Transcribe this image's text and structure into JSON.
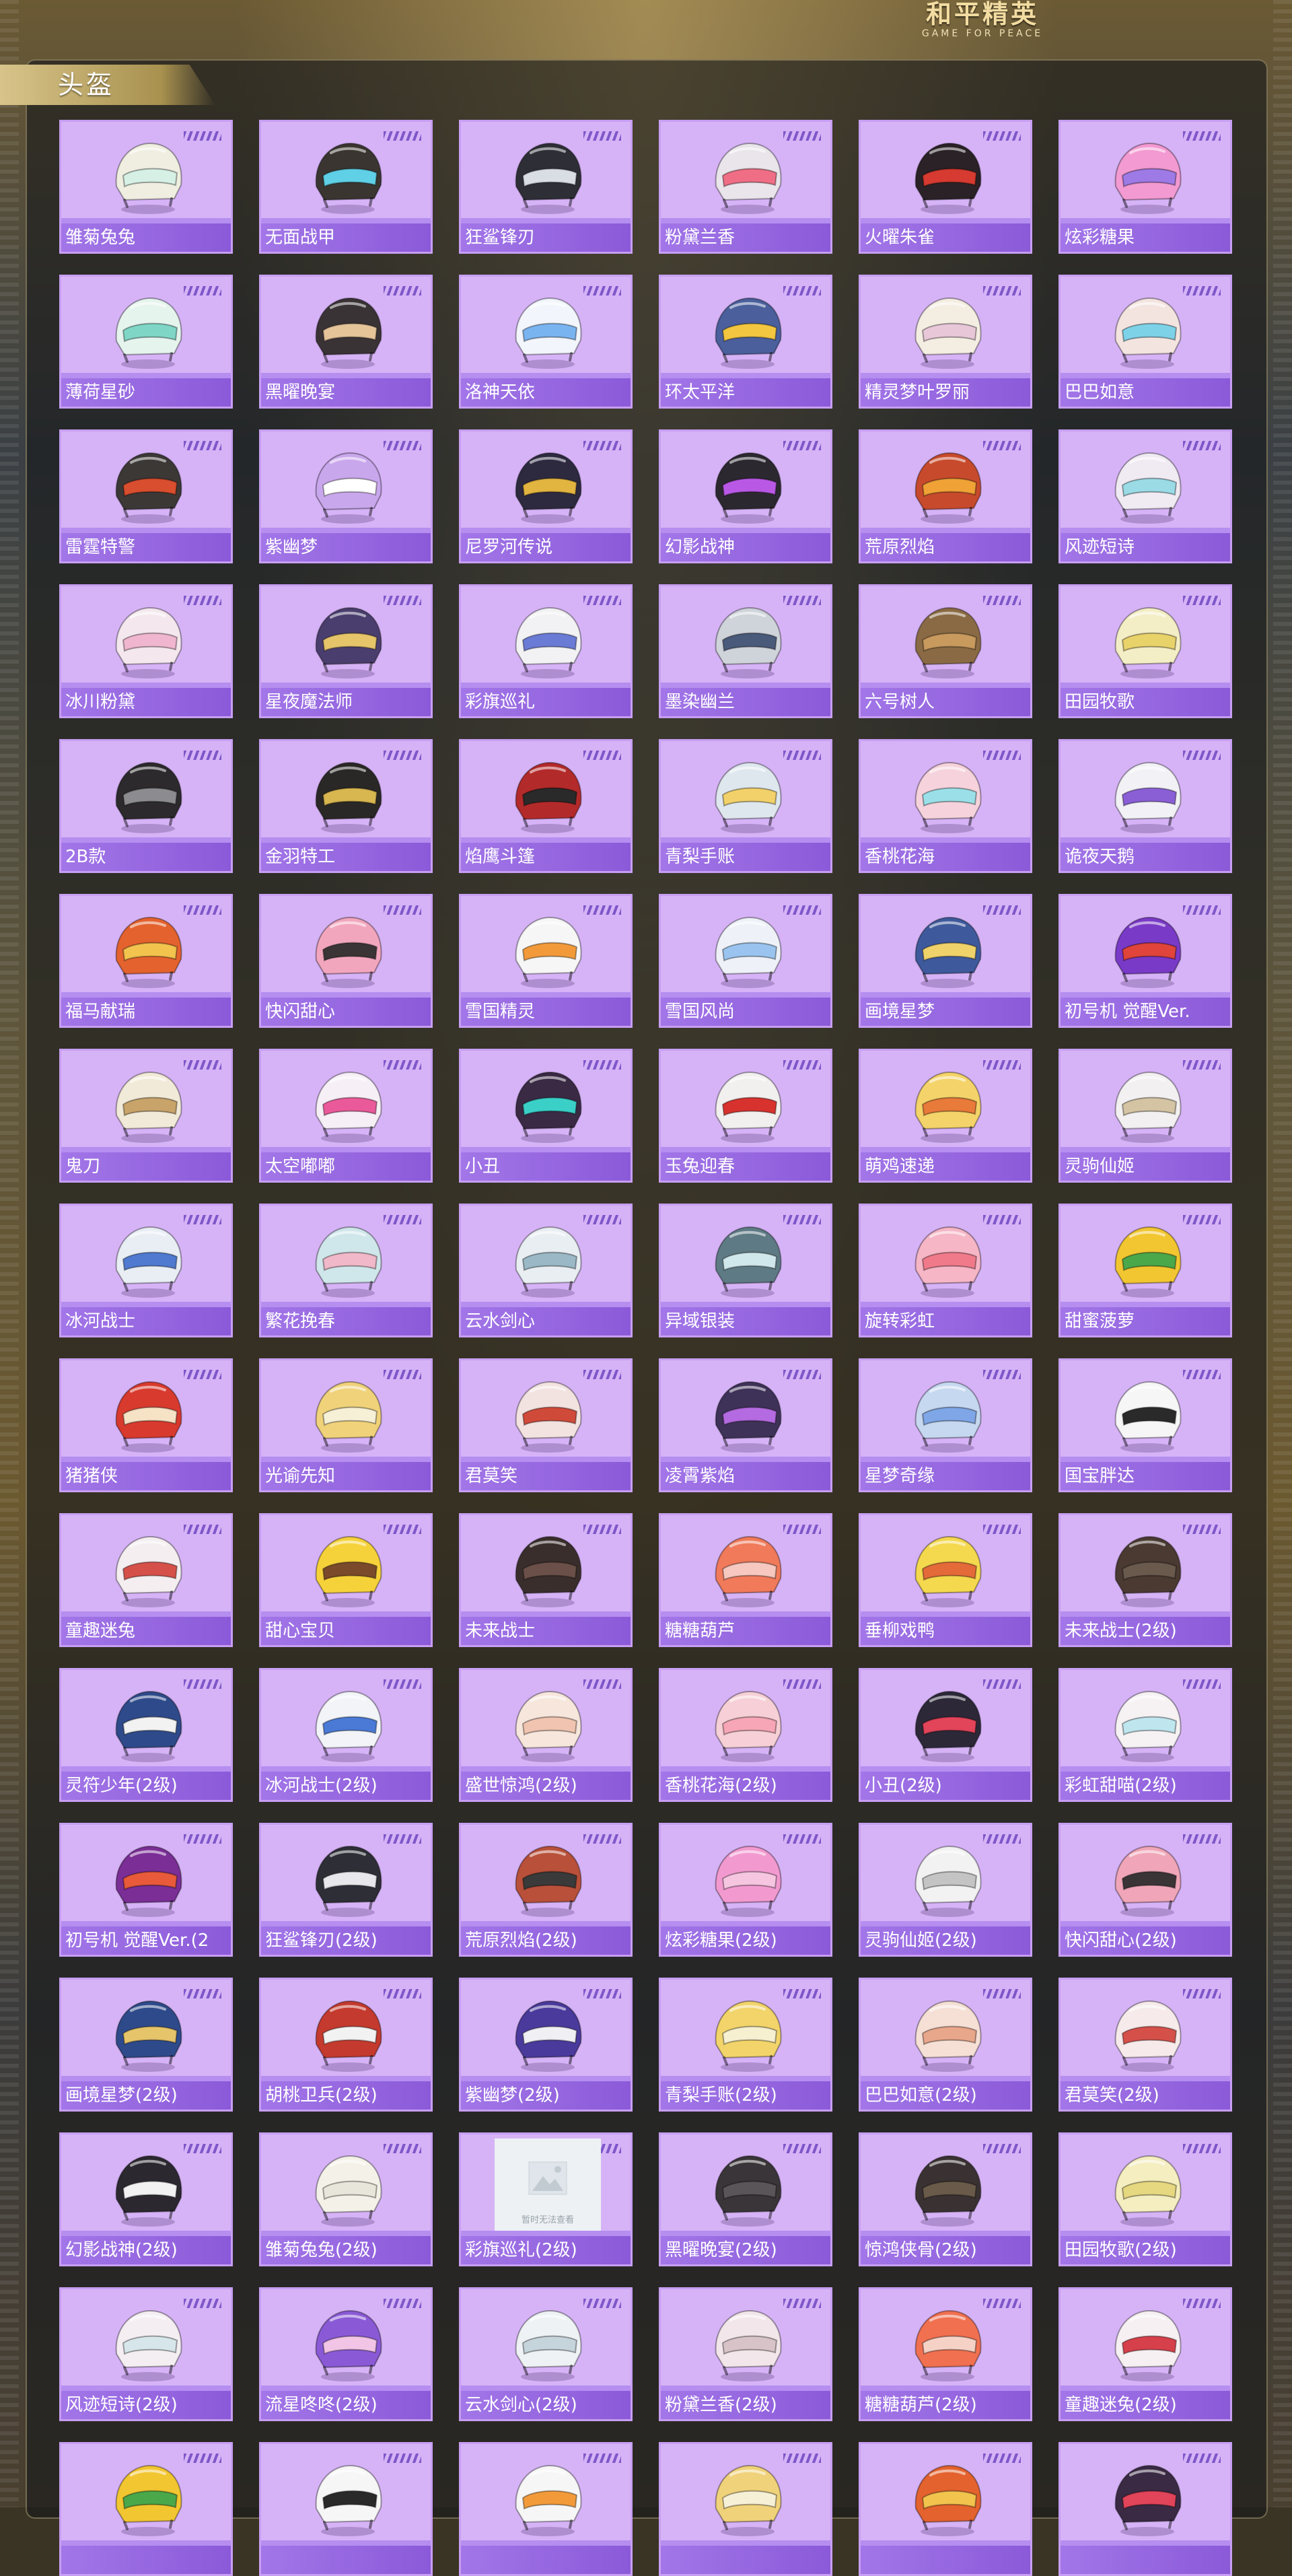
{
  "logo": {
    "main": "和平精英",
    "sub": "GAME FOR PEACE"
  },
  "section": {
    "title": "头盔"
  },
  "placeholder_text": "暂时无法查看",
  "colors": {
    "card_bg": "#d6b3f6",
    "label_bar": "#9a6ee4",
    "label_text": "#ffffff",
    "section_tab": "#c9b271"
  },
  "items": [
    {
      "name": "雏菊兔兔",
      "color": "#efeee0",
      "accent": "#d6f0e6"
    },
    {
      "name": "无面战甲",
      "color": "#3a3530",
      "accent": "#5fd0e6"
    },
    {
      "name": "狂鲨锋刃",
      "color": "#2e2f36",
      "accent": "#d9dde4"
    },
    {
      "name": "粉黛兰香",
      "color": "#e9e5ea",
      "accent": "#ef6e86"
    },
    {
      "name": "火曜朱雀",
      "color": "#2a2226",
      "accent": "#d63a30"
    },
    {
      "name": "炫彩糖果",
      "color": "#f39ad2",
      "accent": "#9e7ae6"
    },
    {
      "name": "薄荷星砂",
      "color": "#e6f4ee",
      "accent": "#7fd6c6"
    },
    {
      "name": "黑曜晚宴",
      "color": "#3a3336",
      "accent": "#e6c49a"
    },
    {
      "name": "洛神天依",
      "color": "#f2f5fb",
      "accent": "#7ab4f0"
    },
    {
      "name": "环太平洋",
      "color": "#4a5f9c",
      "accent": "#f2c640"
    },
    {
      "name": "精灵梦叶罗丽",
      "color": "#f4ede2",
      "accent": "#e8c8d8"
    },
    {
      "name": "巴巴如意",
      "color": "#f4e4e0",
      "accent": "#7ed2e8"
    },
    {
      "name": "雷霆特警",
      "color": "#3b3836",
      "accent": "#d84e2e"
    },
    {
      "name": "紫幽梦",
      "color": "#c9a7ec",
      "accent": "#ffffff"
    },
    {
      "name": "尼罗河传说",
      "color": "#2d2a40",
      "accent": "#e2b440"
    },
    {
      "name": "幻影战神",
      "color": "#2c2830",
      "accent": "#ba58e6"
    },
    {
      "name": "荒原烈焰",
      "color": "#c74a2c",
      "accent": "#f0a236"
    },
    {
      "name": "风迹短诗",
      "color": "#f0eaf2",
      "accent": "#9adbe6"
    },
    {
      "name": "冰川粉黛",
      "color": "#f4e8ee",
      "accent": "#f0b6cf"
    },
    {
      "name": "星夜魔法师",
      "color": "#4a3e6e",
      "accent": "#e6c46a"
    },
    {
      "name": "彩旗巡礼",
      "color": "#f2f2f4",
      "accent": "#6a7bd6"
    },
    {
      "name": "墨染幽兰",
      "color": "#cfd4da",
      "accent": "#4a5a7a"
    },
    {
      "name": "六号树人",
      "color": "#8a6a44",
      "accent": "#c89a5e"
    },
    {
      "name": "田园牧歌",
      "color": "#f4eec6",
      "accent": "#e8d26a"
    },
    {
      "name": "2B款",
      "color": "#2c2a2c",
      "accent": "#8c8c90"
    },
    {
      "name": "金羽特工",
      "color": "#2a2826",
      "accent": "#d8b650"
    },
    {
      "name": "焰鹰斗篷",
      "color": "#b32a2a",
      "accent": "#2a2a2a"
    },
    {
      "name": "青梨手账",
      "color": "#dfe7ee",
      "accent": "#f2d16a"
    },
    {
      "name": "香桃花海",
      "color": "#f6d3dc",
      "accent": "#9be0e8"
    },
    {
      "name": "诡夜天鹅",
      "color": "#f2f2f6",
      "accent": "#8a5fd6"
    },
    {
      "name": "福马献瑞",
      "color": "#e3622e",
      "accent": "#f2c44e"
    },
    {
      "name": "快闪甜心",
      "color": "#f2a6be",
      "accent": "#3a3436"
    },
    {
      "name": "雪国精灵",
      "color": "#f6f6f6",
      "accent": "#f29a3a"
    },
    {
      "name": "雪国风尚",
      "color": "#eef2f8",
      "accent": "#9ac4ef"
    },
    {
      "name": "画境星梦",
      "color": "#3e5a9c",
      "accent": "#f0d26a"
    },
    {
      "name": "初号机 觉醒Ver.",
      "color": "#7a3ac8",
      "accent": "#e0443a"
    },
    {
      "name": "鬼刀",
      "color": "#f2ead8",
      "accent": "#c8a46a"
    },
    {
      "name": "太空嘟嘟",
      "color": "#f6f0f6",
      "accent": "#ea5a9a"
    },
    {
      "name": "小丑",
      "color": "#3a2a44",
      "accent": "#3ad0c8"
    },
    {
      "name": "玉兔迎春",
      "color": "#f2f0ee",
      "accent": "#d8322e"
    },
    {
      "name": "萌鸡速递",
      "color": "#f4d46a",
      "accent": "#e87a3a"
    },
    {
      "name": "灵驹仙姬",
      "color": "#f2f0f0",
      "accent": "#d4c4a4"
    },
    {
      "name": "冰河战士",
      "color": "#e8eef4",
      "accent": "#4f7ad0"
    },
    {
      "name": "繁花挽春",
      "color": "#cfe6ea",
      "accent": "#f0b8c8"
    },
    {
      "name": "云水剑心",
      "color": "#e8eef2",
      "accent": "#9ab8c6"
    },
    {
      "name": "异域银装",
      "color": "#5e7a84",
      "accent": "#d0e8ec"
    },
    {
      "name": "旋转彩虹",
      "color": "#f6b6c6",
      "accent": "#f07a8a"
    },
    {
      "name": "甜蜜菠萝",
      "color": "#f2c631",
      "accent": "#4aa84a"
    },
    {
      "name": "猪猪侠",
      "color": "#d83a2e",
      "accent": "#f6e2c4"
    },
    {
      "name": "光谕先知",
      "color": "#f0d27a",
      "accent": "#f6f0d6"
    },
    {
      "name": "君莫笑",
      "color": "#f2e2e0",
      "accent": "#d04a3a"
    },
    {
      "name": "凌霄紫焰",
      "color": "#3e3258",
      "accent": "#b46ae0"
    },
    {
      "name": "星梦奇缘",
      "color": "#c6d8f0",
      "accent": "#7fa6e6"
    },
    {
      "name": "国宝胖达",
      "color": "#f6f6f6",
      "accent": "#2a2a2a"
    },
    {
      "name": "童趣迷兔",
      "color": "#f4eef0",
      "accent": "#d6504a"
    },
    {
      "name": "甜心宝贝",
      "color": "#f6d23a",
      "accent": "#7a4a2a"
    },
    {
      "name": "未来战士",
      "color": "#3a2e2c",
      "accent": "#6a5048"
    },
    {
      "name": "糖糖葫芦",
      "color": "#f07a5a",
      "accent": "#f6c8c0"
    },
    {
      "name": "垂柳戏鸭",
      "color": "#f4d84e",
      "accent": "#e46a3a"
    },
    {
      "name": "未来战士(2级)",
      "color": "#4a3a32",
      "accent": "#6a5a4e"
    },
    {
      "name": "灵符少年(2级)",
      "color": "#2e4a8a",
      "accent": "#f2f2f2"
    },
    {
      "name": "冰河战士(2级)",
      "color": "#f2f4f8",
      "accent": "#4a7ad6"
    },
    {
      "name": "盛世惊鸿(2级)",
      "color": "#f6e6dc",
      "accent": "#f0c4b0"
    },
    {
      "name": "香桃花海(2级)",
      "color": "#f6d0d6",
      "accent": "#f6a6b6"
    },
    {
      "name": "小丑(2级)",
      "color": "#2c2838",
      "accent": "#e2445a"
    },
    {
      "name": "彩虹甜喵(2级)",
      "color": "#f6f2f4",
      "accent": "#bfe6ef"
    },
    {
      "name": "初号机 觉醒Ver.(2",
      "color": "#7a2e96",
      "accent": "#e85a3a"
    },
    {
      "name": "狂鲨锋刃(2级)",
      "color": "#2e2f36",
      "accent": "#e8e8ec"
    },
    {
      "name": "荒原烈焰(2级)",
      "color": "#b8503a",
      "accent": "#3a3a3a"
    },
    {
      "name": "炫彩糖果(2级)",
      "color": "#f29ad0",
      "accent": "#f6c6e0"
    },
    {
      "name": "灵驹仙姬(2级)",
      "color": "#f2f2f2",
      "accent": "#c4c4c4"
    },
    {
      "name": "快闪甜心(2级)",
      "color": "#f0a6b8",
      "accent": "#3a3436"
    },
    {
      "name": "画境星梦(2级)",
      "color": "#2e4a8a",
      "accent": "#e6c46a"
    },
    {
      "name": "胡桃卫兵(2级)",
      "color": "#c43a2e",
      "accent": "#f2f2f2"
    },
    {
      "name": "紫幽梦(2级)",
      "color": "#4a3a9c",
      "accent": "#f0f0f4"
    },
    {
      "name": "青梨手账(2级)",
      "color": "#f2d46a",
      "accent": "#f6f0d0"
    },
    {
      "name": "巴巴如意(2级)",
      "color": "#f6e0d6",
      "accent": "#e8a68a"
    },
    {
      "name": "君莫笑(2级)",
      "color": "#f6eaea",
      "accent": "#d6504a"
    },
    {
      "name": "幻影战神(2级)",
      "color": "#2c2830",
      "accent": "#f2f2f2"
    },
    {
      "name": "雏菊兔兔(2级)",
      "color": "#f4f2e8",
      "accent": "#e8e6da"
    },
    {
      "name": "彩旗巡礼(2级)",
      "color": "",
      "accent": "",
      "placeholder": true
    },
    {
      "name": "黑曜晚宴(2级)",
      "color": "#3a3538",
      "accent": "#5a5558"
    },
    {
      "name": "惊鸿侠骨(2级)",
      "color": "#3a3232",
      "accent": "#6a5a4a"
    },
    {
      "name": "田园牧歌(2级)",
      "color": "#f4eec0",
      "accent": "#e6d880"
    },
    {
      "name": "风迹短诗(2级)",
      "color": "#f4eef2",
      "accent": "#d6e6ea"
    },
    {
      "name": "流星咚咚(2级)",
      "color": "#8a5ad6",
      "accent": "#f2c4e6"
    },
    {
      "name": "云水剑心(2级)",
      "color": "#eef2f4",
      "accent": "#c6d4dc"
    },
    {
      "name": "粉黛兰香(2级)",
      "color": "#f2e6ea",
      "accent": "#d8c4c8"
    },
    {
      "name": "糖糖葫芦(2级)",
      "color": "#f07050",
      "accent": "#f6d2c6"
    },
    {
      "name": "童趣迷兔(2级)",
      "color": "#f6f0f2",
      "accent": "#d6404a"
    },
    {
      "name": "",
      "color": "#f2c631",
      "accent": "#4aa84a"
    },
    {
      "name": "",
      "color": "#f6f6f6",
      "accent": "#2a2a2a"
    },
    {
      "name": "",
      "color": "#f6f6f6",
      "accent": "#f29a3a"
    },
    {
      "name": "",
      "color": "#f0d27a",
      "accent": "#f6f0d6"
    },
    {
      "name": "",
      "color": "#e3622e",
      "accent": "#f2c44e"
    },
    {
      "name": "",
      "color": "#3a2a44",
      "accent": "#e2445a"
    }
  ]
}
